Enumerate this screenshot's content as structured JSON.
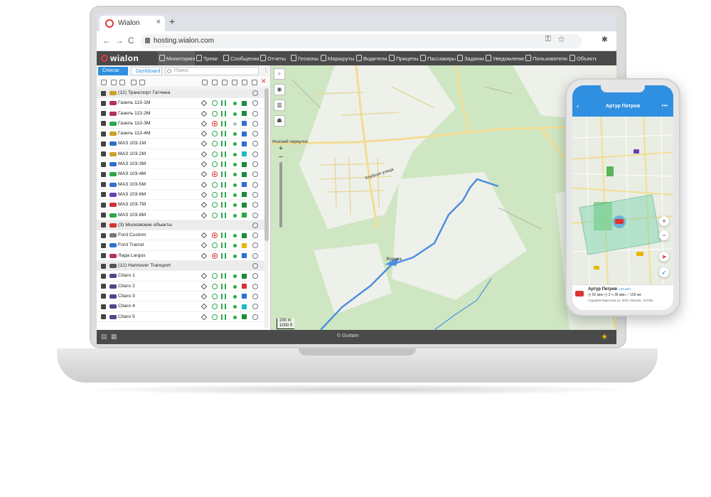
{
  "browser": {
    "tab_title": "Wialon",
    "tab_close": "×",
    "new_tab": "+",
    "url": "hosting.wialon.com",
    "back": "←",
    "forward": "→",
    "reload": "C"
  },
  "app": {
    "logo": "wialon",
    "nav": [
      {
        "label": "Мониторинг",
        "active": true
      },
      {
        "label": "Треки"
      },
      {
        "label": "Сообщения"
      },
      {
        "label": "Отчеты"
      },
      {
        "label": "Геозоны"
      },
      {
        "label": "Маршруты"
      },
      {
        "label": "Водители"
      },
      {
        "label": "Прицепы"
      },
      {
        "label": "Пассажиры"
      },
      {
        "label": "Задания"
      },
      {
        "label": "Уведомления"
      },
      {
        "label": "Пользователи"
      },
      {
        "label": "Объекты"
      }
    ]
  },
  "panel": {
    "tab_list": "Список",
    "tab_dashboard": "Dashboard",
    "search_placeholder": "Поиск",
    "menu": "⋮",
    "rows": [
      {
        "type": "group",
        "name": "(12) Транспорт Гатчина",
        "icon_color": "#c9a227"
      },
      {
        "name": "Газель 113-1М",
        "icon_color": "#b5305a",
        "status": "go",
        "dot": "#2da84a",
        "square": "#1b8a3a"
      },
      {
        "name": "Газель 113-2М",
        "icon_color": "#b5305a",
        "status": "go",
        "dot": "#2da84a",
        "square": "#1b8a3a"
      },
      {
        "name": "Газель 113-3М",
        "icon_color": "#2da84a",
        "status": "stop",
        "dot": "#bbbbbb",
        "square": "#2f6fd0"
      },
      {
        "name": "Газель 113-4М",
        "icon_color": "#c9a227",
        "status": "go",
        "dot": "#2da84a",
        "square": "#2f6fd0"
      },
      {
        "name": "МАЗ 103-1М",
        "icon_color": "#2f6fd0",
        "status": "go",
        "dot": "#2da84a",
        "square": "#2f6fd0"
      },
      {
        "name": "МАЗ 103-2М",
        "icon_color": "#c9a227",
        "status": "go",
        "dot": "#2da84a",
        "square": "#22b8c4"
      },
      {
        "name": "МАЗ 103-3М",
        "icon_color": "#2f6fd0",
        "status": "go",
        "dot": "#2da84a",
        "square": "#1b8a3a"
      },
      {
        "name": "МАЗ 103-4М",
        "icon_color": "#2da84a",
        "status": "stop",
        "dot": "#2da84a",
        "square": "#1b8a3a"
      },
      {
        "name": "МАЗ 103-5М",
        "icon_color": "#2f6fd0",
        "status": "go",
        "dot": "#2da84a",
        "square": "#2f6fd0"
      },
      {
        "name": "МАЗ 103-6М",
        "icon_color": "#6a3fb5",
        "status": "go",
        "dot": "#2da84a",
        "square": "#1b8a3a"
      },
      {
        "name": "МАЗ 103-7М",
        "icon_color": "#d33333",
        "status": "go",
        "dot": "#2da84a",
        "square": "#1b8a3a"
      },
      {
        "name": "МАЗ 103-8М",
        "icon_color": "#2da84a",
        "status": "go",
        "dot": "#2da84a",
        "square": "#2da84a"
      },
      {
        "type": "group",
        "name": "(3) Московские объекты",
        "icon_color": "#d33333"
      },
      {
        "name": "Ford Custom",
        "icon_color": "#777777",
        "status": "stop",
        "dot": "#2da84a",
        "square": "#1b8a3a"
      },
      {
        "name": "Ford Transit",
        "icon_color": "#2f6fd0",
        "status": "go",
        "dot": "#2da84a",
        "square": "#e8b600"
      },
      {
        "name": "Лада Largus",
        "icon_color": "#b5305a",
        "status": "stop",
        "dot": "#2da84a",
        "square": "#2f6fd0"
      },
      {
        "type": "group",
        "name": "(12) Hannover Transport",
        "icon_color": "#555555"
      },
      {
        "name": "Citaro 1",
        "icon_color": "#4a4a8a",
        "status": "go",
        "dot": "#2da84a",
        "square": "#1b8a3a"
      },
      {
        "name": "Citaro 2",
        "icon_color": "#4a4a8a",
        "status": "go",
        "dot": "#2da84a",
        "square": "#d33333"
      },
      {
        "name": "Citaro 3",
        "icon_color": "#4a4a8a",
        "status": "go",
        "dot": "#2da84a",
        "square": "#2f6fd0"
      },
      {
        "name": "Citaro 4",
        "icon_color": "#4a4a8a",
        "status": "go",
        "dot": "#2da84a",
        "square": "#22b8c4"
      },
      {
        "name": "Citaro 5",
        "icon_color": "#4a4a8a",
        "status": "go",
        "dot": "#2da84a",
        "square": "#1b8a3a"
      }
    ]
  },
  "map": {
    "labels": {
      "lane": "Нозский переулок",
      "street": "Клубная улица",
      "river": "Жданка"
    },
    "scale_m": "200 m",
    "scale_ft": "1000 ft",
    "zoom_in": "+",
    "zoom_out": "−"
  },
  "status": {
    "copyright": "© Gurtam",
    "star": "★"
  },
  "phone": {
    "title": "Артур Потров",
    "back": "‹",
    "menu": "•••",
    "zoom_in": "+",
    "zoom_out": "−",
    "unit_name": "Артур Петров",
    "unit_speed": "126 км/ч",
    "stats": "◷ 50 мин   ◷ 2 ч 36 мин   ⟋ 156 км",
    "address": "Садовая-Каретная ул, 20/2, Москва, 127051"
  },
  "colors": {
    "accent": "#2f8fe0",
    "nav_bg": "#4a4a4a",
    "map_green": "#cfe6c3",
    "road_yellow": "#f2dd94",
    "river_blue": "#4d8fe0"
  }
}
